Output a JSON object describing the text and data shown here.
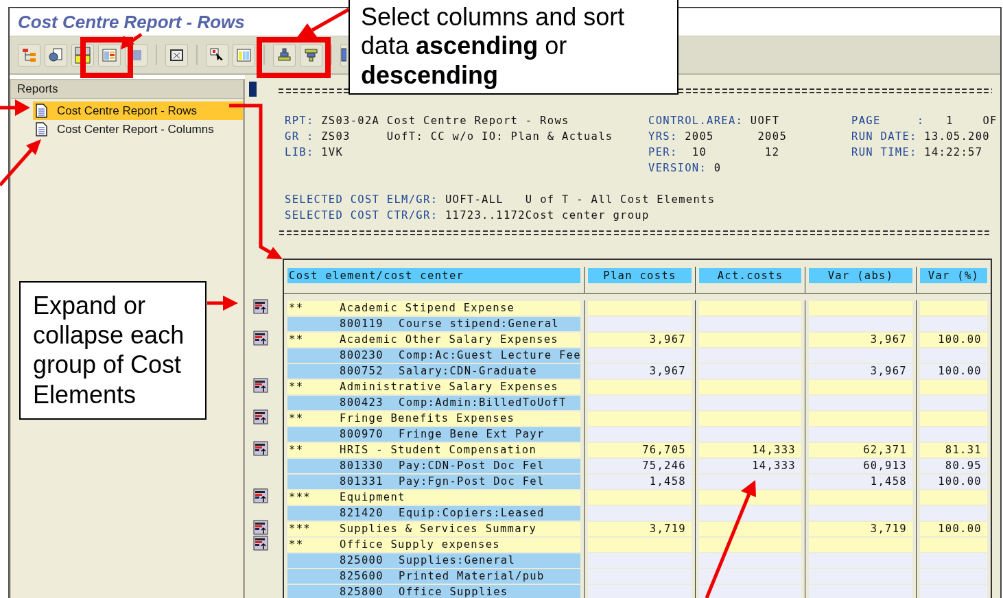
{
  "window": {
    "title": "Cost Centre Report - Rows"
  },
  "sidebar": {
    "title": "Reports",
    "items": [
      {
        "label": "Cost Centre Report - Rows",
        "selected": true
      },
      {
        "label": "Cost Center Report - Columns",
        "selected": false
      }
    ]
  },
  "report": {
    "header_columns": [
      [
        {
          "label": "RPT:",
          "value": "ZS03-02A Cost Centre Report - Rows"
        },
        {
          "label": "GR :",
          "value": "ZS03     UofT: CC w/o IO: Plan & Actuals"
        },
        {
          "label": "LIB:",
          "value": "1VK"
        }
      ],
      [
        {
          "label": "CONTROL.AREA:",
          "value": "UOFT"
        },
        {
          "label": "YRS:",
          "value": "2005      2005"
        },
        {
          "label": "PER:",
          "value": " 10        12"
        },
        {
          "label": "VERSION:",
          "value": "0"
        }
      ],
      [
        {
          "label": "PAGE     :",
          "value": "  1    OF"
        },
        {
          "label": "RUN DATE:",
          "value": "13.05.200"
        },
        {
          "label": "RUN TIME:",
          "value": "14:22:57"
        }
      ]
    ],
    "selection": [
      {
        "label": "SELECTED COST ELM/GR:",
        "value": "UOFT-ALL   U of T - All Cost Elements"
      },
      {
        "label": "SELECTED COST CTR/GR:",
        "value": "11723..1172Cost center group"
      }
    ],
    "table": {
      "columns": [
        "Cost element/cost center",
        "Plan costs",
        "Act.costs",
        "Var (abs)",
        "Var (%)"
      ],
      "rows": [
        {
          "kind": "group",
          "marker": "**",
          "label": "Academic Stipend Expense"
        },
        {
          "kind": "item",
          "code": "800119",
          "label": "Course stipend:General"
        },
        {
          "kind": "group",
          "marker": "**",
          "label": "Academic Other Salary Expenses",
          "plan": "3,967",
          "var_abs": "3,967",
          "var_pct": "100.00"
        },
        {
          "kind": "item",
          "code": "800230",
          "label": "Comp:Ac:Guest Lecture Fee"
        },
        {
          "kind": "item",
          "code": "800752",
          "label": "Salary:CDN-Graduate",
          "plan": "3,967",
          "var_abs": "3,967",
          "var_pct": "100.00"
        },
        {
          "kind": "group",
          "marker": "**",
          "label": "Administrative Salary Expenses"
        },
        {
          "kind": "item",
          "code": "800423",
          "label": "Comp:Admin:BilledToUofT"
        },
        {
          "kind": "group",
          "marker": "**",
          "label": "Fringe Benefits Expenses"
        },
        {
          "kind": "item",
          "code": "800970",
          "label": "Fringe Bene Ext Payr"
        },
        {
          "kind": "group",
          "marker": "**",
          "label": "HRIS - Student Compensation",
          "plan": "76,705",
          "actual": "14,333",
          "var_abs": "62,371",
          "var_pct": "81.31"
        },
        {
          "kind": "item",
          "code": "801330",
          "label": "Pay:CDN-Post Doc Fel",
          "plan": "75,246",
          "actual": "14,333",
          "var_abs": "60,913",
          "var_pct": "80.95"
        },
        {
          "kind": "item",
          "code": "801331",
          "label": "Pay:Fgn-Post Doc Fel",
          "plan": "1,458",
          "var_abs": "1,458",
          "var_pct": "100.00"
        },
        {
          "kind": "group",
          "marker": "***",
          "label": "Equipment"
        },
        {
          "kind": "item",
          "code": "821420",
          "label": "Equip:Copiers:Leased"
        },
        {
          "kind": "group",
          "marker": "***",
          "label": "Supplies & Services Summary",
          "plan": "3,719",
          "var_abs": "3,719",
          "var_pct": "100.00"
        },
        {
          "kind": "group",
          "marker": "**",
          "label": "Office Supply expenses"
        },
        {
          "kind": "item",
          "code": "825000",
          "label": "Supplies:General"
        },
        {
          "kind": "item",
          "code": "825600",
          "label": "Printed Material/pub"
        },
        {
          "kind": "item",
          "code": "825800",
          "label": "Office Supplies"
        }
      ]
    }
  },
  "callouts": [
    {
      "kind": "top",
      "text": "Select columns and sort data **ascending** or **descending**"
    },
    {
      "kind": "left",
      "text": "Expand or collapse each group of Cost Elements"
    }
  ]
}
